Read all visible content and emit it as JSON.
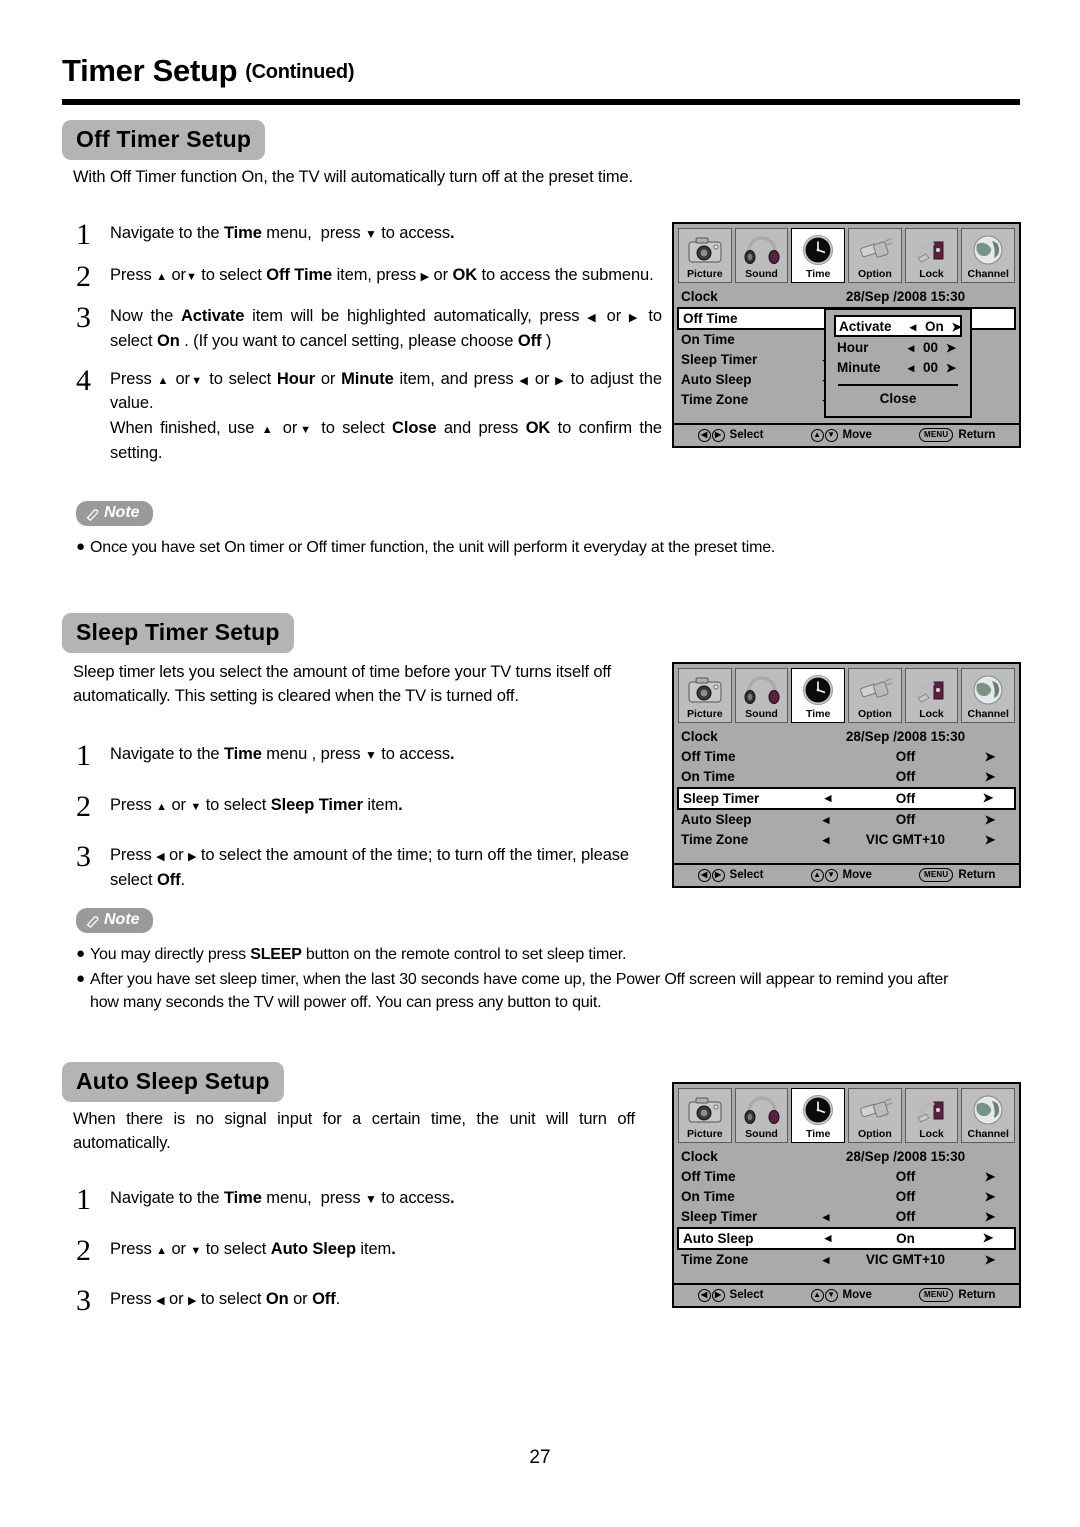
{
  "header": {
    "title": "Timer Setup",
    "continued": "(Continued)"
  },
  "sections": {
    "off_timer": {
      "badge": "Off Timer Setup",
      "intro": "With Off Timer function On, the TV will automatically turn off at the preset time.",
      "steps": [
        {
          "num": "1",
          "text": "Navigate to the Time menu,  press ▼ to access."
        },
        {
          "num": "2",
          "text": "Press ▲ or ▼ to select Off Time item, press ▸ or OK to access the submenu."
        },
        {
          "num": "3",
          "text": "Now the Activate item will be highlighted automatically, press ◂ or ▸ to select On . (If you want to cancel setting, please choose Off )"
        },
        {
          "num": "4",
          "text": "Press ▲ or ▼ to select Hour or Minute item, and press ◂ or ▸ to adjust the value. When finished, use ▲ or ▼ to select Close and press OK to confirm the setting."
        }
      ],
      "note": {
        "label": "Note",
        "items": [
          "Once you have set On timer or Off timer function, the unit will perform it everyday at the preset time."
        ]
      }
    },
    "sleep_timer": {
      "badge": "Sleep Timer Setup",
      "intro": "Sleep timer lets you select the amount of time before your TV turns itself off automatically. This setting is cleared when the TV is turned off.",
      "steps": [
        {
          "num": "1",
          "text": "Navigate to the Time menu , press ▼ to access."
        },
        {
          "num": "2",
          "text": "Press ▲ or ▼ to select Sleep Timer item."
        },
        {
          "num": "3",
          "text": "Press ◂ or ▸ to select the amount of the time; to turn off the timer, please select Off."
        }
      ],
      "note": {
        "label": "Note",
        "items": [
          "You may directly press SLEEP button on the remote control to set sleep timer.",
          "After you have set sleep timer, when the last 30 seconds have come up, the Power Off screen will appear to remind you after how many seconds the TV will power off. You can press any button to quit."
        ]
      }
    },
    "auto_sleep": {
      "badge": "Auto Sleep Setup",
      "intro": "When there is no signal input for a certain time, the unit will turn off automatically.",
      "steps": [
        {
          "num": "1",
          "text": "Navigate to the Time menu,  press ▼ to access."
        },
        {
          "num": "2",
          "text": "Press ▲ or ▼ to select Auto Sleep item."
        },
        {
          "num": "3",
          "text": "Press ◂ or ▸ to select On or Off."
        }
      ]
    }
  },
  "osd_tabs": [
    {
      "label": "Picture",
      "icon": "camera-icon",
      "active": false
    },
    {
      "label": "Sound",
      "icon": "headphones-icon",
      "active": false
    },
    {
      "label": "Time",
      "icon": "clock-icon",
      "active": true
    },
    {
      "label": "Option",
      "icon": "connector-icon",
      "active": false
    },
    {
      "label": "Lock",
      "icon": "padlock-icon",
      "active": false
    },
    {
      "label": "Channel",
      "icon": "globe-icon",
      "active": false
    }
  ],
  "osd_footer": {
    "select": "Select",
    "move": "Move",
    "return": "Return",
    "menu_key": "MENU"
  },
  "osd1": {
    "rows": [
      {
        "label": "Clock",
        "left": "",
        "value": "28/Sep  /2008 15:30",
        "right": "",
        "type": "clock",
        "highlight": false
      },
      {
        "label": "Off Time",
        "left": "",
        "value": "",
        "right": "",
        "type": "plain",
        "highlight": true
      },
      {
        "label": "On Time",
        "left": "",
        "value": "",
        "right": "",
        "type": "plain",
        "highlight": false
      },
      {
        "label": "Sleep Timer",
        "left": "◂",
        "value": "",
        "right": "",
        "type": "plain",
        "highlight": false
      },
      {
        "label": "Auto Sleep",
        "left": "◂",
        "value": "",
        "right": "",
        "type": "plain",
        "highlight": false
      },
      {
        "label": "Time Zone",
        "left": "◂",
        "value": "",
        "right": "",
        "type": "plain",
        "highlight": false
      }
    ],
    "popup": {
      "rows": [
        {
          "label": "Activate",
          "left": "◂",
          "value": "On",
          "right": "➤",
          "highlight": true
        },
        {
          "label": "Hour",
          "left": "◂",
          "value": "00",
          "right": "➤",
          "highlight": false
        },
        {
          "label": "Minute",
          "left": "◂",
          "value": "00",
          "right": "➤",
          "highlight": false
        }
      ],
      "close": "Close"
    }
  },
  "osd2": {
    "rows": [
      {
        "label": "Clock",
        "left": "",
        "value": "28/Sep  /2008 15:30",
        "right": "",
        "type": "clock",
        "highlight": false
      },
      {
        "label": "Off Time",
        "left": "",
        "value": "Off",
        "right": "➤",
        "type": "value",
        "highlight": false
      },
      {
        "label": "On Time",
        "left": "",
        "value": "Off",
        "right": "➤",
        "type": "value",
        "highlight": false
      },
      {
        "label": "Sleep Timer",
        "left": "◂",
        "value": "Off",
        "right": "➤",
        "type": "value",
        "highlight": true
      },
      {
        "label": "Auto Sleep",
        "left": "◂",
        "value": "Off",
        "right": "➤",
        "type": "value",
        "highlight": false
      },
      {
        "label": "Time Zone",
        "left": "◂",
        "value": "VIC GMT+10",
        "right": "➤",
        "type": "value",
        "highlight": false
      }
    ]
  },
  "osd3": {
    "rows": [
      {
        "label": "Clock",
        "left": "",
        "value": "28/Sep  /2008 15:30",
        "right": "",
        "type": "clock",
        "highlight": false
      },
      {
        "label": "Off Time",
        "left": "",
        "value": "Off",
        "right": "➤",
        "type": "value",
        "highlight": false
      },
      {
        "label": "On Time",
        "left": "",
        "value": "Off",
        "right": "➤",
        "type": "value",
        "highlight": false
      },
      {
        "label": "Sleep Timer",
        "left": "◂",
        "value": "Off",
        "right": "➤",
        "type": "value",
        "highlight": false
      },
      {
        "label": "Auto Sleep",
        "left": "◂",
        "value": "On",
        "right": "➤",
        "type": "value",
        "highlight": true
      },
      {
        "label": "Time Zone",
        "left": "◂",
        "value": "VIC GMT+10",
        "right": "➤",
        "type": "value",
        "highlight": false
      }
    ]
  },
  "page_number": "27",
  "colors": {
    "badge_gray": "#b4b4b4",
    "note_gray": "#9a9a9a",
    "osd_bg": "#aaaaaa",
    "osd_tab": "#bdbdbd"
  }
}
